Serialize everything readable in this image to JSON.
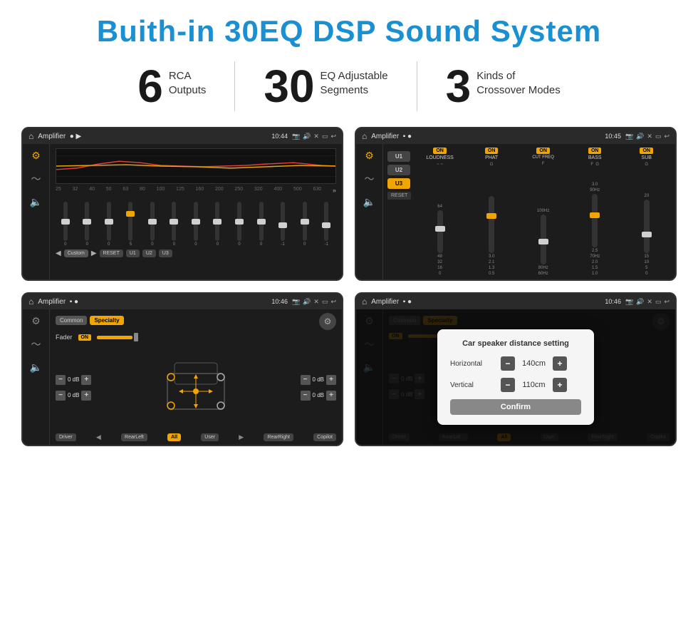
{
  "header": {
    "title": "Buith-in 30EQ DSP Sound System"
  },
  "stats": [
    {
      "number": "6",
      "label": "RCA\nOutputs"
    },
    {
      "number": "30",
      "label": "EQ Adjustable\nSegments"
    },
    {
      "number": "3",
      "label": "Kinds of\nCrossover Modes"
    }
  ],
  "screens": [
    {
      "id": "screen1",
      "topbar": {
        "title": "Amplifier",
        "time": "10:44"
      },
      "type": "eq",
      "freqs": [
        "25",
        "32",
        "40",
        "50",
        "63",
        "80",
        "100",
        "125",
        "160",
        "200",
        "250",
        "320",
        "400",
        "500",
        "630"
      ],
      "values": [
        "0",
        "0",
        "0",
        "5",
        "0",
        "0",
        "0",
        "0",
        "0",
        "0",
        "-1",
        "0",
        "-1"
      ],
      "presets": [
        "Custom",
        "RESET",
        "U1",
        "U2",
        "U3"
      ]
    },
    {
      "id": "screen2",
      "topbar": {
        "title": "Amplifier",
        "time": "10:45"
      },
      "type": "crossover",
      "presets": [
        "U1",
        "U2",
        "U3"
      ],
      "channels": [
        "LOUDNESS",
        "PHAT",
        "CUT FREQ",
        "BASS",
        "SUB"
      ],
      "status": "ON"
    },
    {
      "id": "screen3",
      "topbar": {
        "title": "Amplifier",
        "time": "10:46"
      },
      "type": "fader",
      "tabs": [
        "Common",
        "Specialty"
      ],
      "faderLabel": "Fader",
      "faderStatus": "ON",
      "buttons": [
        "Driver",
        "RearLeft",
        "All",
        "User",
        "RearRight",
        "Copilot"
      ],
      "dbValues": [
        "0 dB",
        "0 dB",
        "0 dB",
        "0 dB"
      ]
    },
    {
      "id": "screen4",
      "topbar": {
        "title": "Amplifier",
        "time": "10:46"
      },
      "type": "distance",
      "tabs": [
        "Common",
        "Specialty"
      ],
      "dialog": {
        "title": "Car speaker distance setting",
        "horizontal": {
          "label": "Horizontal",
          "value": "140cm"
        },
        "vertical": {
          "label": "Vertical",
          "value": "110cm"
        },
        "confirm": "Confirm"
      },
      "buttons": [
        "Driver",
        "RearLeft",
        "All",
        "User",
        "RearRight",
        "Copilot"
      ],
      "dbValues": [
        "0 dB",
        "0 dB"
      ]
    }
  ]
}
